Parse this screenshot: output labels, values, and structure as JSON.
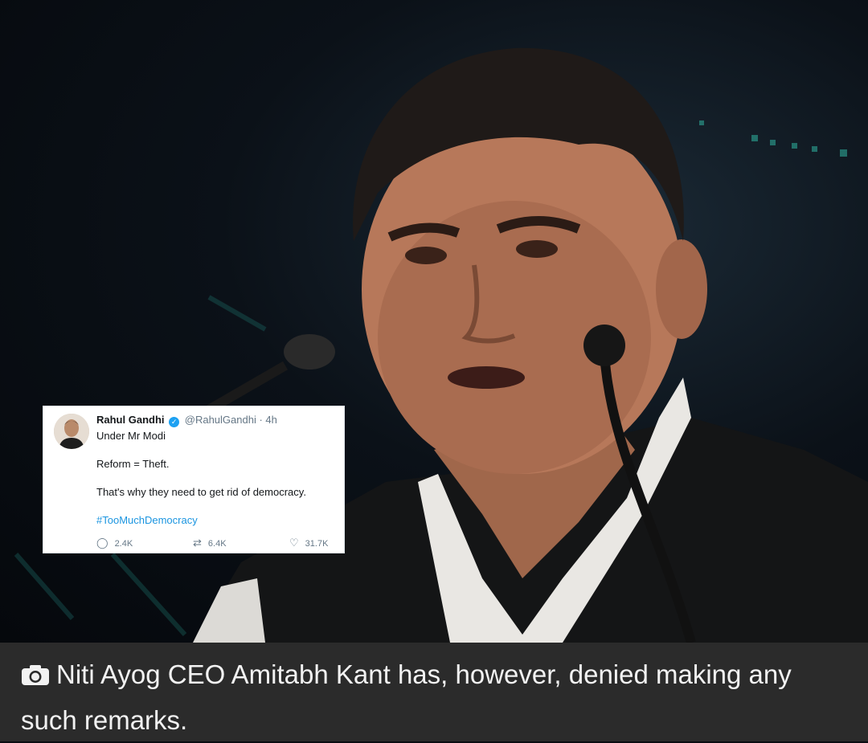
{
  "tweet": {
    "name": "Rahul Gandhi",
    "handle": "@RahulGandhi · 4h",
    "lines": [
      "Under Mr Modi",
      "Reform = Theft.",
      "That's why they need to get rid of democracy."
    ],
    "hashtag": "#TooMuchDemocracy",
    "replies": "2.4K",
    "retweets": "6.4K",
    "likes": "31.7K"
  },
  "caption": {
    "text": "Niti Ayog CEO Amitabh Kant has, however, denied making any such remarks."
  },
  "colors": {
    "caption_bg": "#2b2b2b",
    "twitter_blue": "#1da1f2"
  }
}
